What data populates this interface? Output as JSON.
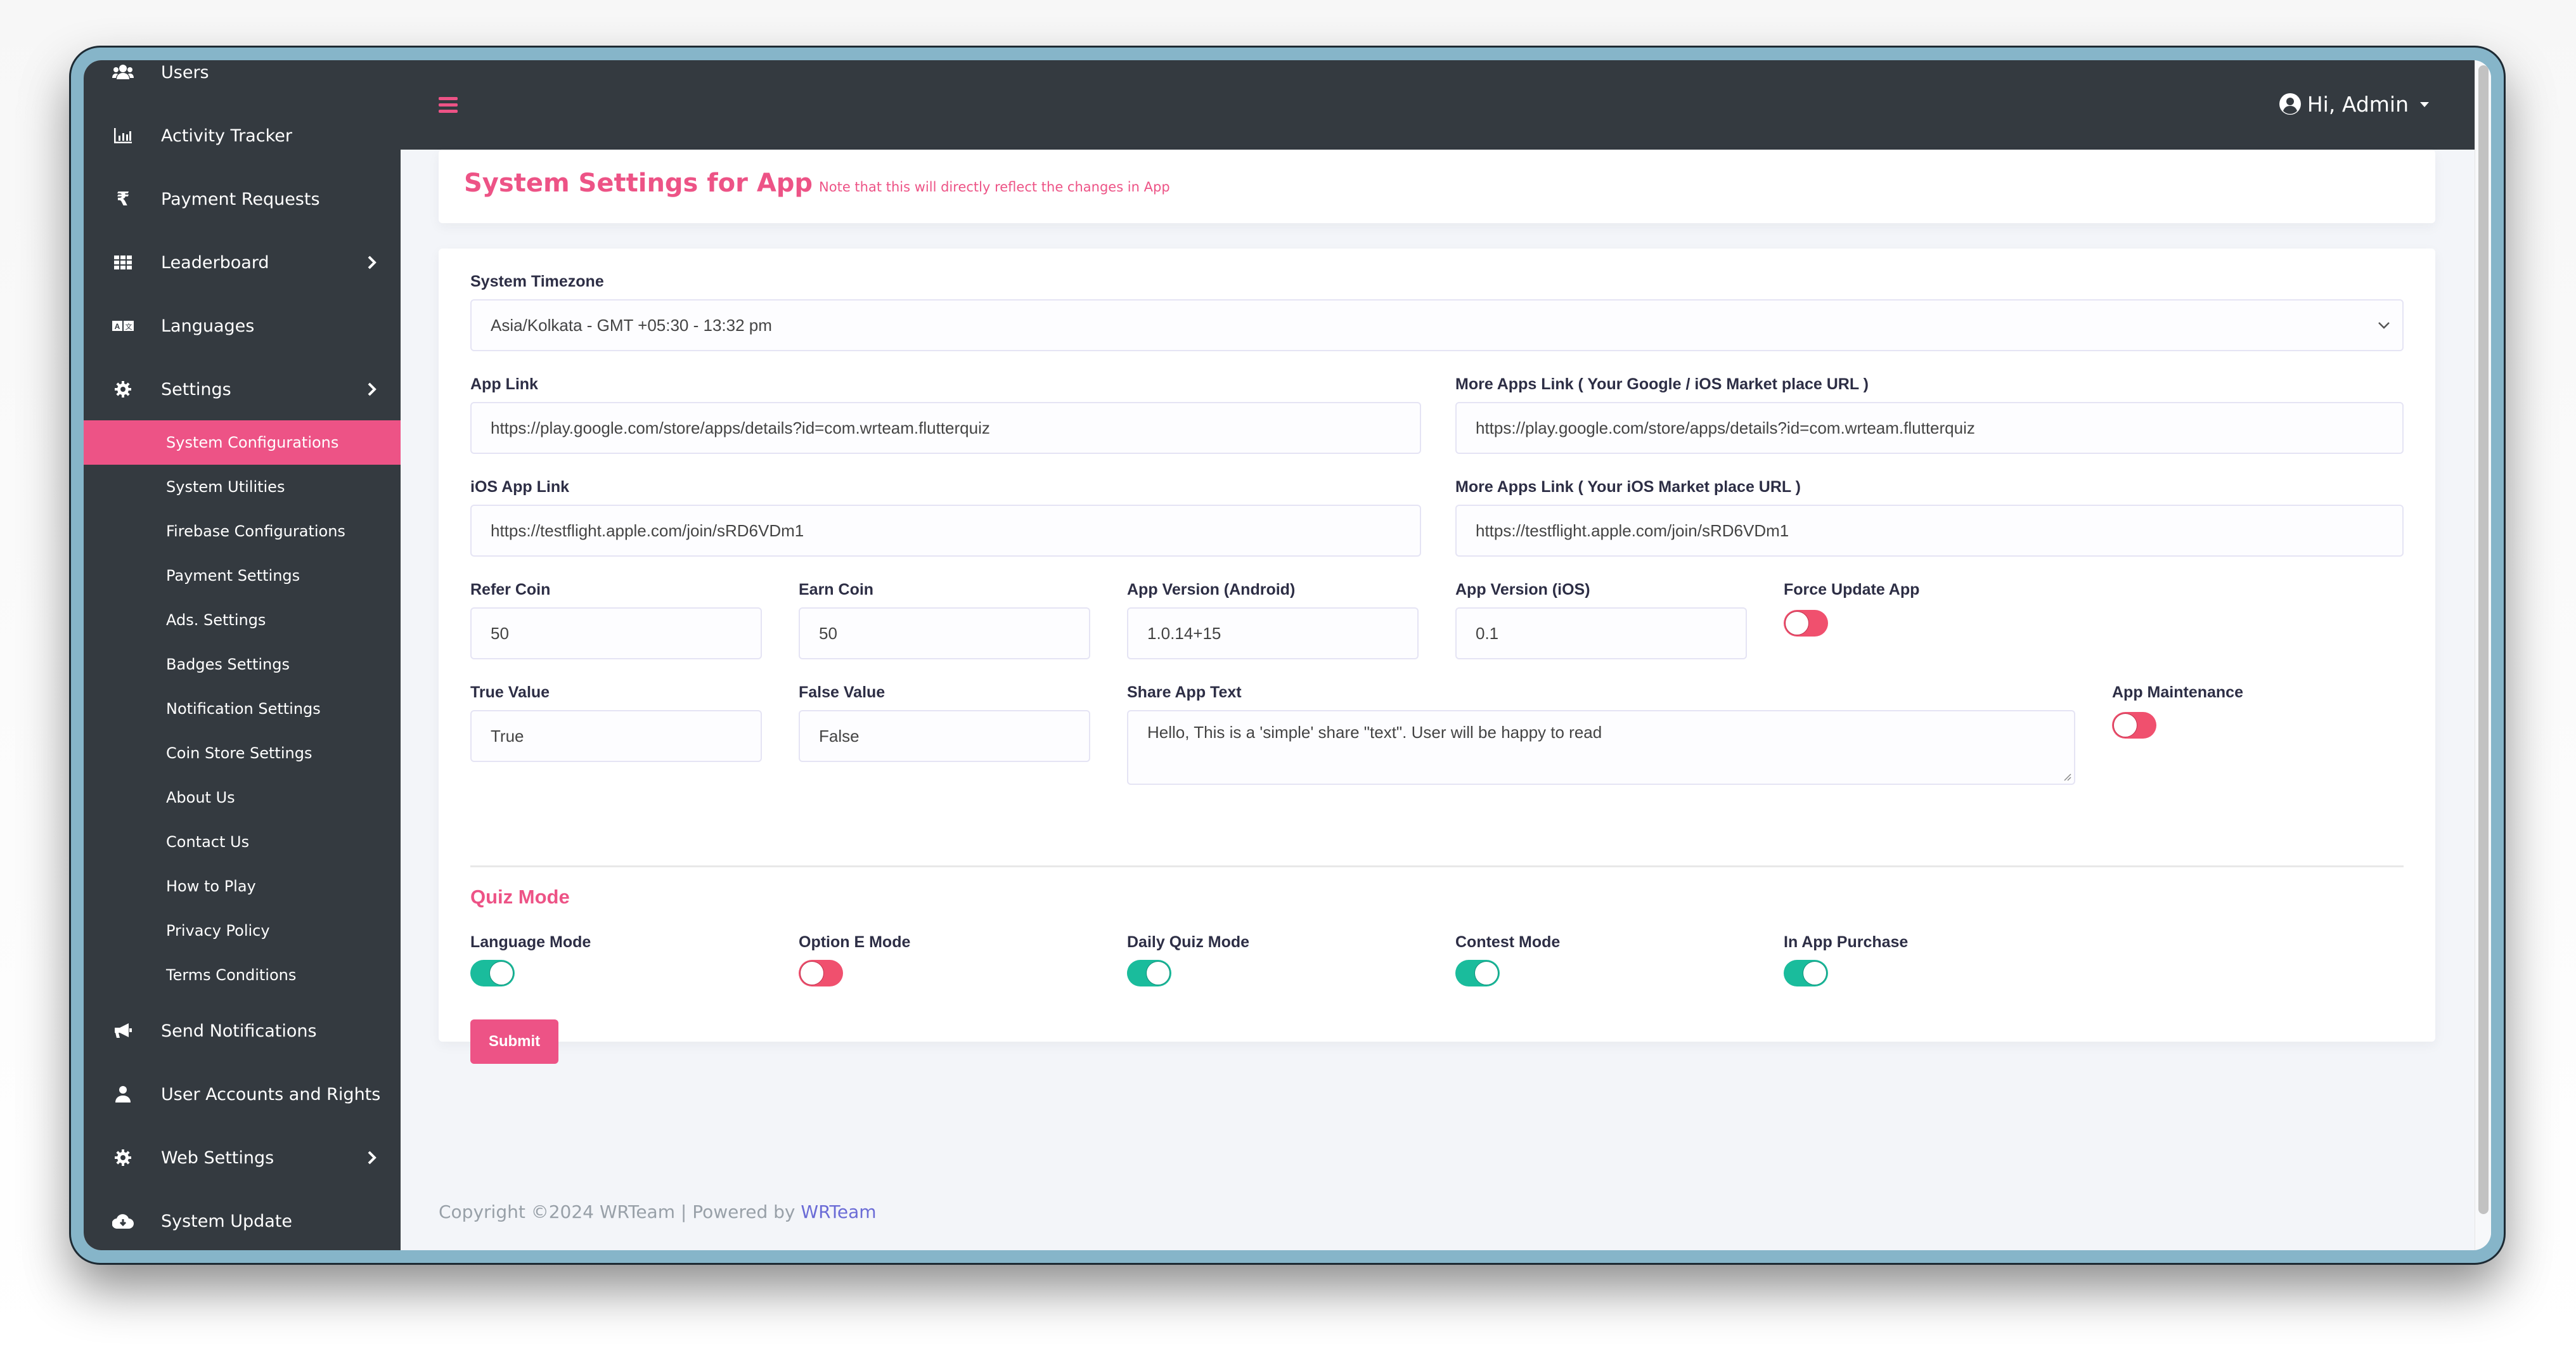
{
  "sidebar": {
    "items": [
      {
        "label": "Users",
        "icon": "users-icon",
        "has_submenu": false
      },
      {
        "label": "Activity Tracker",
        "icon": "chart-bar-icon",
        "has_submenu": false
      },
      {
        "label": "Payment Requests",
        "icon": "rupee-icon",
        "has_submenu": false
      },
      {
        "label": "Leaderboard",
        "icon": "grid-icon",
        "has_submenu": true
      },
      {
        "label": "Languages",
        "icon": "language-icon",
        "has_submenu": false
      },
      {
        "label": "Settings",
        "icon": "gear-icon",
        "has_submenu": true
      }
    ],
    "settings_submenu": [
      {
        "label": "System Configurations",
        "active": true
      },
      {
        "label": "System Utilities",
        "active": false
      },
      {
        "label": "Firebase Configurations",
        "active": false
      },
      {
        "label": "Payment Settings",
        "active": false
      },
      {
        "label": "Ads. Settings",
        "active": false
      },
      {
        "label": "Badges Settings",
        "active": false
      },
      {
        "label": "Notification Settings",
        "active": false
      },
      {
        "label": "Coin Store Settings",
        "active": false
      },
      {
        "label": "About Us",
        "active": false
      },
      {
        "label": "Contact Us",
        "active": false
      },
      {
        "label": "How to Play",
        "active": false
      },
      {
        "label": "Privacy Policy",
        "active": false
      },
      {
        "label": "Terms Conditions",
        "active": false
      }
    ],
    "bottom_items": [
      {
        "label": "Send Notifications",
        "icon": "megaphone-icon",
        "has_submenu": false
      },
      {
        "label": "User Accounts and Rights",
        "icon": "user-icon",
        "has_submenu": false
      },
      {
        "label": "Web Settings",
        "icon": "gear-icon",
        "has_submenu": true
      },
      {
        "label": "System Update",
        "icon": "cloud-download-icon",
        "has_submenu": false
      }
    ]
  },
  "header": {
    "menu_icon": "hamburger-icon",
    "user_greeting": "Hi, Admin"
  },
  "page": {
    "title": "System Settings for App",
    "note": "Note that this will directly reflect the changes in App"
  },
  "form": {
    "system_timezone": {
      "label": "System Timezone",
      "value": "Asia/Kolkata - GMT +05:30 - 13:32 pm"
    },
    "app_link": {
      "label": "App Link",
      "value": "https://play.google.com/store/apps/details?id=com.wrteam.flutterquiz"
    },
    "more_apps_link": {
      "label": "More Apps Link ( Your Google / iOS Market place URL )",
      "value": "https://play.google.com/store/apps/details?id=com.wrteam.flutterquiz"
    },
    "ios_app_link": {
      "label": "iOS App Link",
      "value": "https://testflight.apple.com/join/sRD6VDm1"
    },
    "more_apps_link_ios": {
      "label": "More Apps Link ( Your iOS Market place URL )",
      "value": "https://testflight.apple.com/join/sRD6VDm1"
    },
    "refer_coin": {
      "label": "Refer Coin",
      "value": "50"
    },
    "earn_coin": {
      "label": "Earn Coin",
      "value": "50"
    },
    "app_version_android": {
      "label": "App Version (Android)",
      "value": "1.0.14+15"
    },
    "app_version_ios": {
      "label": "App Version (iOS)",
      "value": "0.1"
    },
    "force_update_app": {
      "label": "Force Update App",
      "enabled": false
    },
    "true_value": {
      "label": "True Value",
      "value": "True"
    },
    "false_value": {
      "label": "False Value",
      "value": "False"
    },
    "share_app_text": {
      "label": "Share App Text",
      "value": "Hello, This is a 'simple' share \"text\". User will be happy to read"
    },
    "app_maintenance": {
      "label": "App Maintenance",
      "enabled": false
    }
  },
  "quiz_mode": {
    "title": "Quiz Mode",
    "toggles": [
      {
        "label": "Language Mode",
        "enabled": true
      },
      {
        "label": "Option E Mode",
        "enabled": false
      },
      {
        "label": "Daily Quiz Mode",
        "enabled": true
      },
      {
        "label": "Contest Mode",
        "enabled": true
      },
      {
        "label": "In App Purchase",
        "enabled": true
      }
    ],
    "submit_label": "Submit"
  },
  "footer": {
    "copyright": "Copyright ©2024 WRTeam | Powered by ",
    "link_text": "WRTeam"
  },
  "colors": {
    "accent": "#ed5386",
    "sidebar_bg": "#343a40",
    "toggle_on": "#1abc9c",
    "toggle_off": "#f0506e",
    "link": "#6a6bd6"
  }
}
